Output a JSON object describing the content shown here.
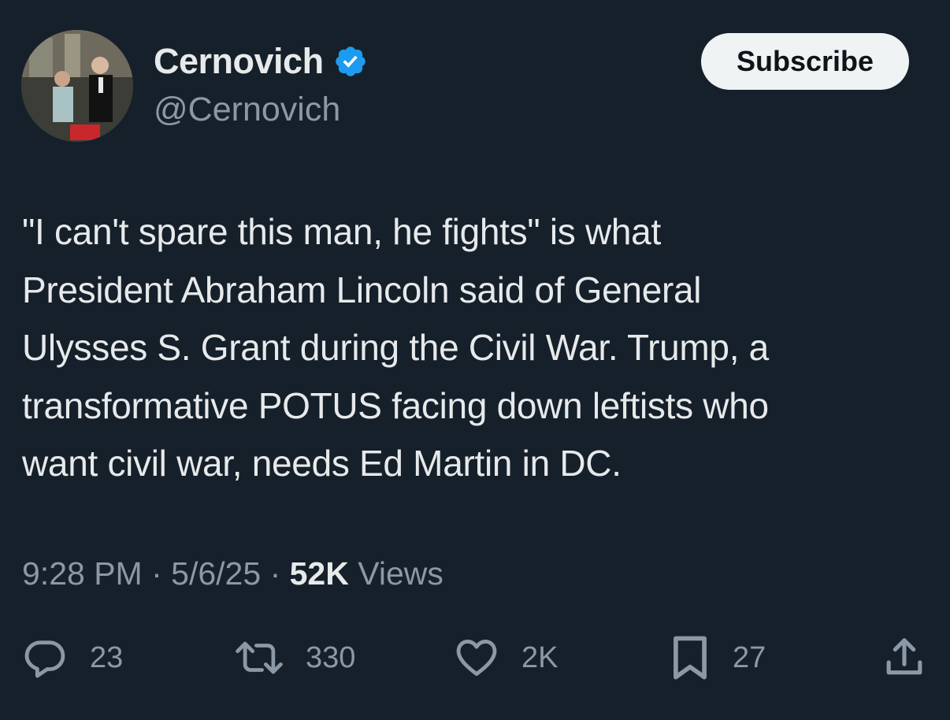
{
  "author": {
    "display_name": "Cernovich",
    "handle": "@Cernovich",
    "verified": true
  },
  "subscribe_label": "Subscribe",
  "tweet_lines": [
    "\"I can't spare this man, he fights\" is what",
    "President Abraham Lincoln said of General",
    "Ulysses S. Grant during the Civil War. Trump, a",
    "transformative POTUS facing down leftists who",
    "want civil war, needs Ed Martin in DC."
  ],
  "meta": {
    "time": "9:28 PM",
    "separator": "·",
    "date": "5/6/25",
    "views_count": "52K",
    "views_label": "Views"
  },
  "actions": {
    "replies": "23",
    "reposts": "330",
    "likes": "2K",
    "bookmarks": "27"
  },
  "colors": {
    "background": "#15202b",
    "text_primary": "#e7e9ea",
    "text_secondary": "#8b98a5",
    "verified": "#1d9bf0",
    "button_bg": "#eff3f4"
  }
}
